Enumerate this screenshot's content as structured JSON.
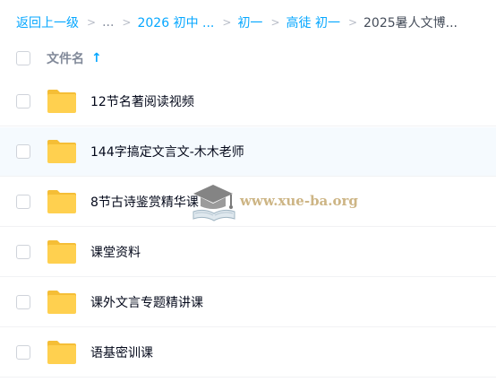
{
  "breadcrumb": {
    "back": "返回上一级",
    "root_ellipsis": "...",
    "separator": ">",
    "items": [
      {
        "label": "2026 初中 ..."
      },
      {
        "label": "初一"
      },
      {
        "label": "高徒 初一"
      }
    ],
    "current": "2025暑人文博..."
  },
  "table": {
    "column_name": "文件名",
    "sort_icon_glyph": "↑"
  },
  "files": [
    {
      "name": "12节名著阅读视频",
      "type": "folder"
    },
    {
      "name": "144字搞定文言文-木木老师",
      "type": "folder"
    },
    {
      "name": "8节古诗鉴赏精华课",
      "type": "folder"
    },
    {
      "name": "课堂资料",
      "type": "folder"
    },
    {
      "name": "课外文言专题精讲课",
      "type": "folder"
    },
    {
      "name": "语基密训课",
      "type": "folder"
    }
  ],
  "watermark": {
    "text": "www.xue-ba.org"
  },
  "colors": {
    "accent": "#06a7ff",
    "folder": "#ffd04f",
    "folder_tab": "#f5be36",
    "text": "#03081a",
    "muted": "#818999",
    "hover_row": "#f5fafe"
  },
  "icons": {
    "sort": "arrow-up-icon",
    "item": "folder-icon",
    "watermark": "graduation-cap-book-icon"
  }
}
